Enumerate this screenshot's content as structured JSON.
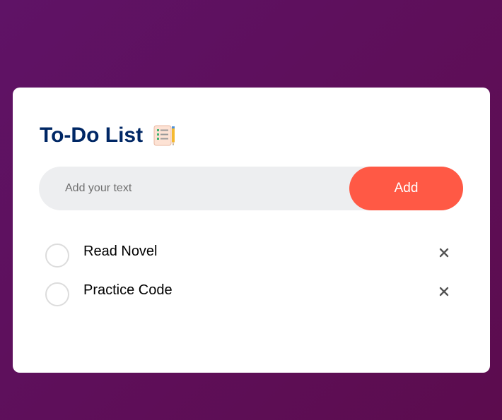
{
  "app": {
    "title": "To-Do List",
    "title_icon": "notepad-checklist-icon"
  },
  "input": {
    "placeholder": "Add your text",
    "value": "",
    "add_label": "Add"
  },
  "tasks": [
    {
      "label": "Read Novel",
      "checked": false
    },
    {
      "label": "Practice Code",
      "checked": false
    }
  ],
  "colors": {
    "background_gradient_start": "#5f1366",
    "background_gradient_end": "#5c0c4e",
    "card": "#ffffff",
    "title": "#002765",
    "input_bg": "#edeef0",
    "add_button": "#ff5945",
    "check_border": "#dcdcdc",
    "delete_icon": "#555555"
  }
}
